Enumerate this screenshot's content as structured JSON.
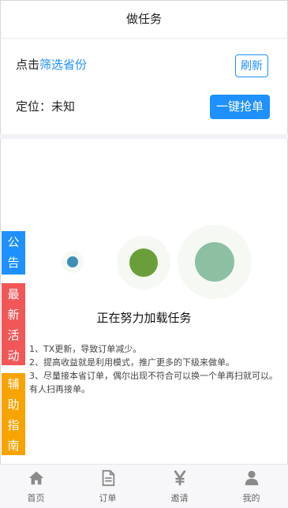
{
  "header": {
    "title": "做任务"
  },
  "filter": {
    "prefix": "点击",
    "link": "筛选省份",
    "refresh_label": "刷新"
  },
  "location": {
    "text": "定位：未知",
    "grab_label": "一键抢单"
  },
  "loading": {
    "text": "正在努力加载任务",
    "dot_colors": [
      "#3d8fb7",
      "#6a9e3a",
      "#8dbfa3"
    ]
  },
  "tips": [
    "1、TX更新，导致订单减少。",
    "2、提高收益就是利用模式，推广更多的下级来做单。",
    "3、尽量接本省订单，偶尔出现不符合可以换一个单再扫就可以。有人扫再接单。"
  ],
  "side_tabs": {
    "notice": [
      "公",
      "告"
    ],
    "activity": [
      "最",
      "新",
      "活",
      "动"
    ],
    "guide": [
      "辅",
      "助",
      "指",
      "南"
    ]
  },
  "tabbar": {
    "items": [
      {
        "label": "首页",
        "icon": "home-icon"
      },
      {
        "label": "订单",
        "icon": "document-icon"
      },
      {
        "label": "邀请",
        "icon": "yen-icon"
      },
      {
        "label": "我的",
        "icon": "user-icon"
      }
    ]
  },
  "colors": {
    "accent": "#1e90ff",
    "notice_tab": "#1e90ff",
    "activity_tab": "#f25757",
    "guide_tab": "#f7a300"
  }
}
